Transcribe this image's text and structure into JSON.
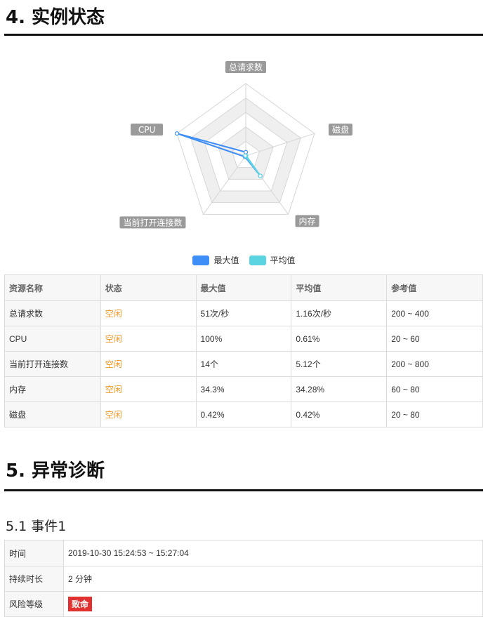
{
  "section4": {
    "title": "4. 实例状态"
  },
  "chart_data": {
    "type": "radar",
    "indicators": [
      "总请求数",
      "磁盘",
      "内存",
      "当前打开连接数",
      "CPU"
    ],
    "max_percent": 100,
    "series": [
      {
        "name": "最大值",
        "color": "#3d8ef7",
        "values": [
          5.1,
          0.42,
          34.3,
          1.75,
          100
        ]
      },
      {
        "name": "平均值",
        "color": "#5bd4e2",
        "values": [
          0.29,
          0.42,
          34.28,
          0.64,
          0.61
        ]
      }
    ],
    "legend_position": "bottom"
  },
  "resource_table": {
    "headers": [
      "资源名称",
      "状态",
      "最大值",
      "平均值",
      "参考值"
    ],
    "rows": [
      [
        "总请求数",
        "空闲",
        "51次/秒",
        "1.16次/秒",
        "200 ~ 400"
      ],
      [
        "CPU",
        "空闲",
        "100%",
        "0.61%",
        "20 ~ 60"
      ],
      [
        "当前打开连接数",
        "空闲",
        "14个",
        "5.12个",
        "200 ~ 800"
      ],
      [
        "内存",
        "空闲",
        "34.3%",
        "34.28%",
        "60 ~ 80"
      ],
      [
        "磁盘",
        "空闲",
        "0.42%",
        "0.42%",
        "20 ~ 80"
      ]
    ]
  },
  "section5": {
    "title": "5. 异常诊断"
  },
  "event1": {
    "title": "5.1 事件1",
    "rows": [
      {
        "label": "时间",
        "value": "2019-10-30 15:24:53 ~ 15:27:04"
      },
      {
        "label": "持续时长",
        "value": "2 分钟"
      },
      {
        "label": "风险等级",
        "value": "致命"
      }
    ],
    "risk_color": "#e03030"
  }
}
